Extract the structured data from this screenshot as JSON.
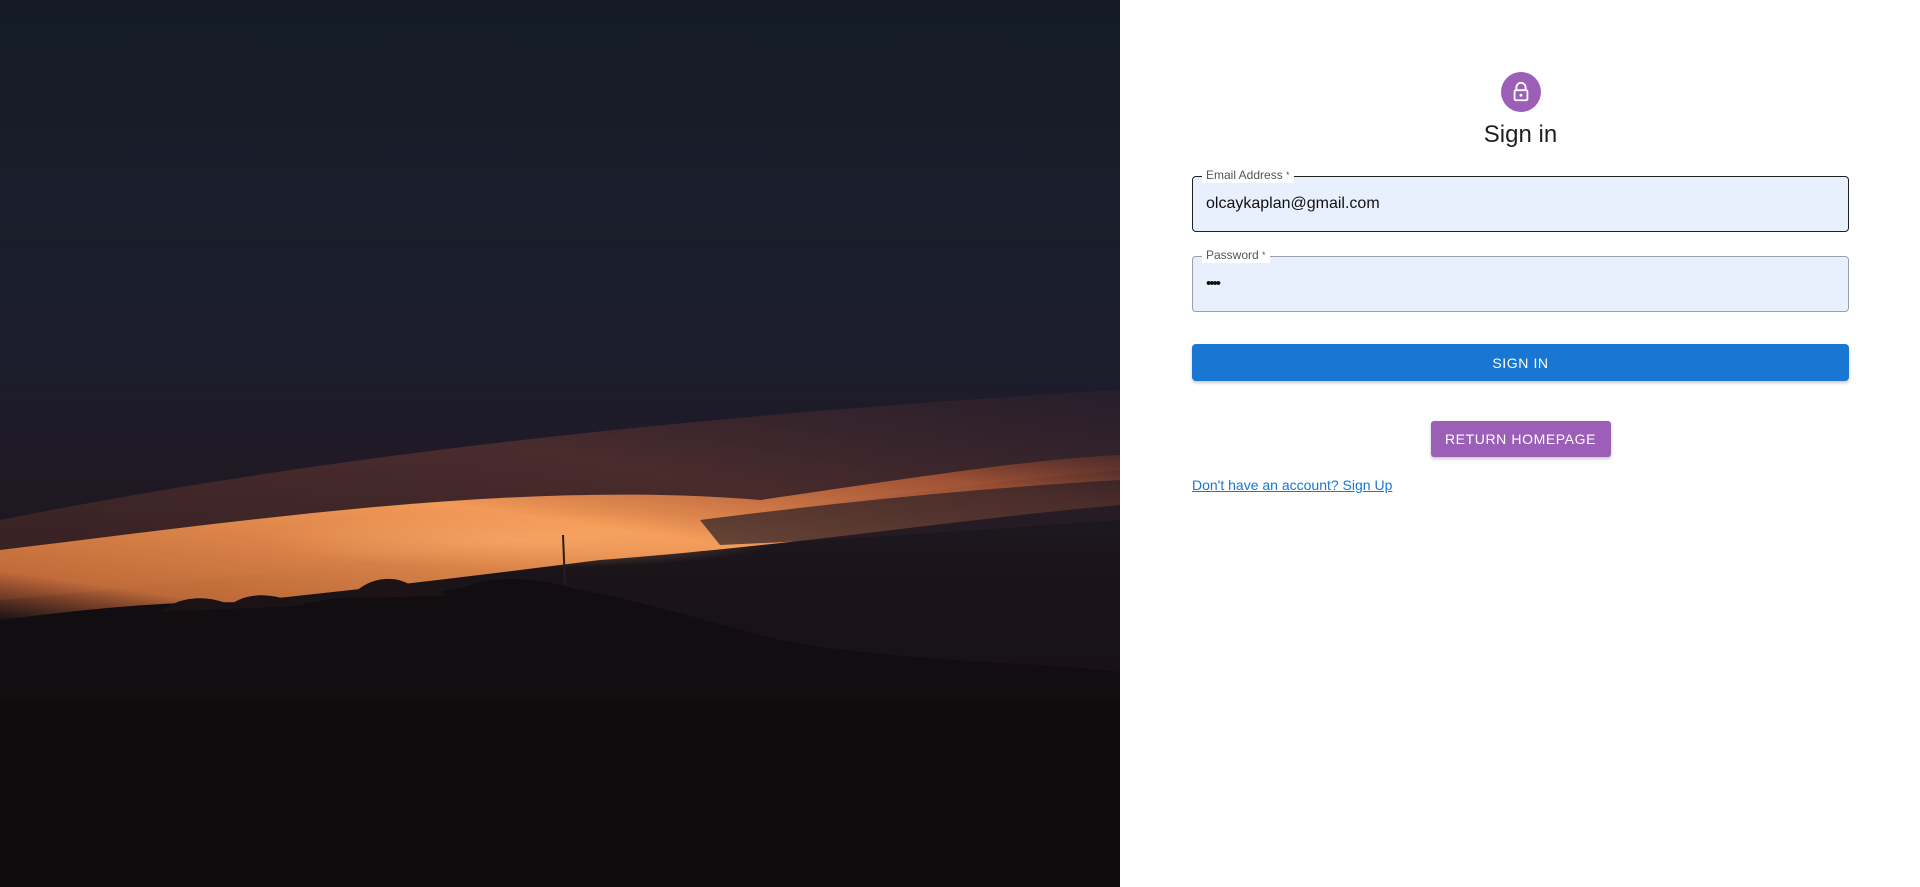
{
  "hero": {
    "image": "sunset-landscape-photo"
  },
  "form": {
    "icon": "lock-icon",
    "title": "Sign in",
    "email": {
      "label": "Email Address",
      "required_mark": "*",
      "value": "olcaykaplan@gmail.com"
    },
    "password": {
      "label": "Password",
      "required_mark": "*",
      "value": "••••"
    },
    "sign_in_label": "SIGN IN",
    "return_label": "RETURN HOMEPAGE",
    "signup_link": "Don't have an account? Sign Up"
  },
  "colors": {
    "primary": "#1976d2",
    "secondary": "#9c5fb8",
    "input_fill": "#e8f0fe"
  }
}
